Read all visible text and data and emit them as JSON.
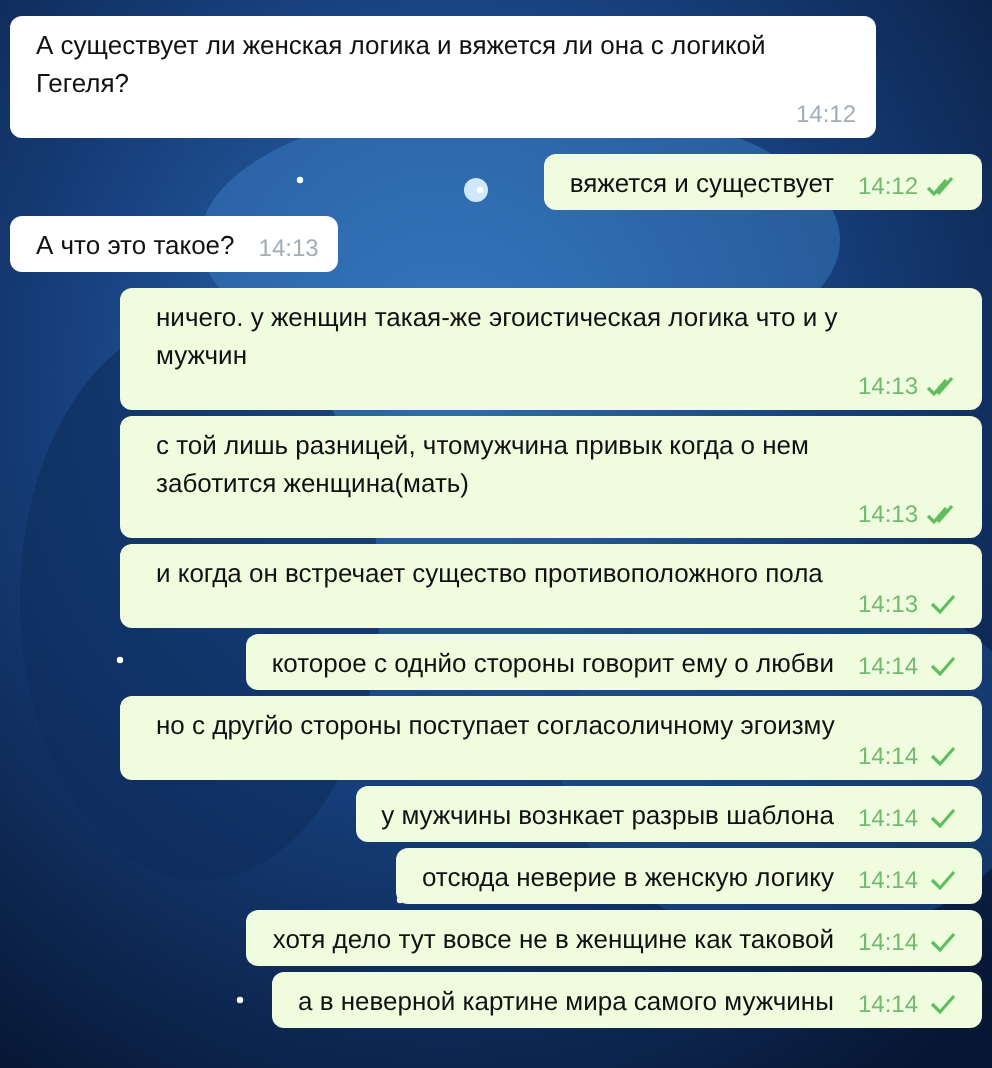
{
  "messages": [
    {
      "kind": "incoming",
      "text": "А существует ли женская логика и вяжется ли она с логикой Гегеля?",
      "time": "14:12"
    },
    {
      "kind": "outgoing",
      "text": "вяжется и существует",
      "time": "14:12",
      "read": true
    },
    {
      "kind": "incoming",
      "text": "А что это такое?",
      "time": "14:13"
    },
    {
      "kind": "outgoing",
      "text": "ничего. у женщин такая-же эгоистическая логика что и у мужчин",
      "time": "14:13",
      "read": true
    },
    {
      "kind": "outgoing",
      "text": "с той лишь разницей, чтомужчина привык когда о нем заботится женщина(мать)",
      "time": "14:13",
      "read": true
    },
    {
      "kind": "outgoing",
      "text": "и когда он встречает существо противоположного пола",
      "time": "14:13",
      "read": false
    },
    {
      "kind": "outgoing",
      "text": "которое с однйо стороны говорит ему о любви",
      "time": "14:14",
      "read": false
    },
    {
      "kind": "outgoing",
      "text": "но с другйо стороны поступает согласоличному эгоизму",
      "time": "14:14",
      "read": false
    },
    {
      "kind": "outgoing",
      "text": "у мужчины вознкает разрыв шаблона",
      "time": "14:14",
      "read": false
    },
    {
      "kind": "outgoing",
      "text": "отсюда неверие в женскую логику",
      "time": "14:14",
      "read": false
    },
    {
      "kind": "outgoing",
      "text": "хотя дело тут вовсе не в женщине как таковой",
      "time": "14:14",
      "read": false
    },
    {
      "kind": "outgoing",
      "text": "а в неверной картине мира самого мужчины",
      "time": "14:14",
      "read": false
    }
  ]
}
